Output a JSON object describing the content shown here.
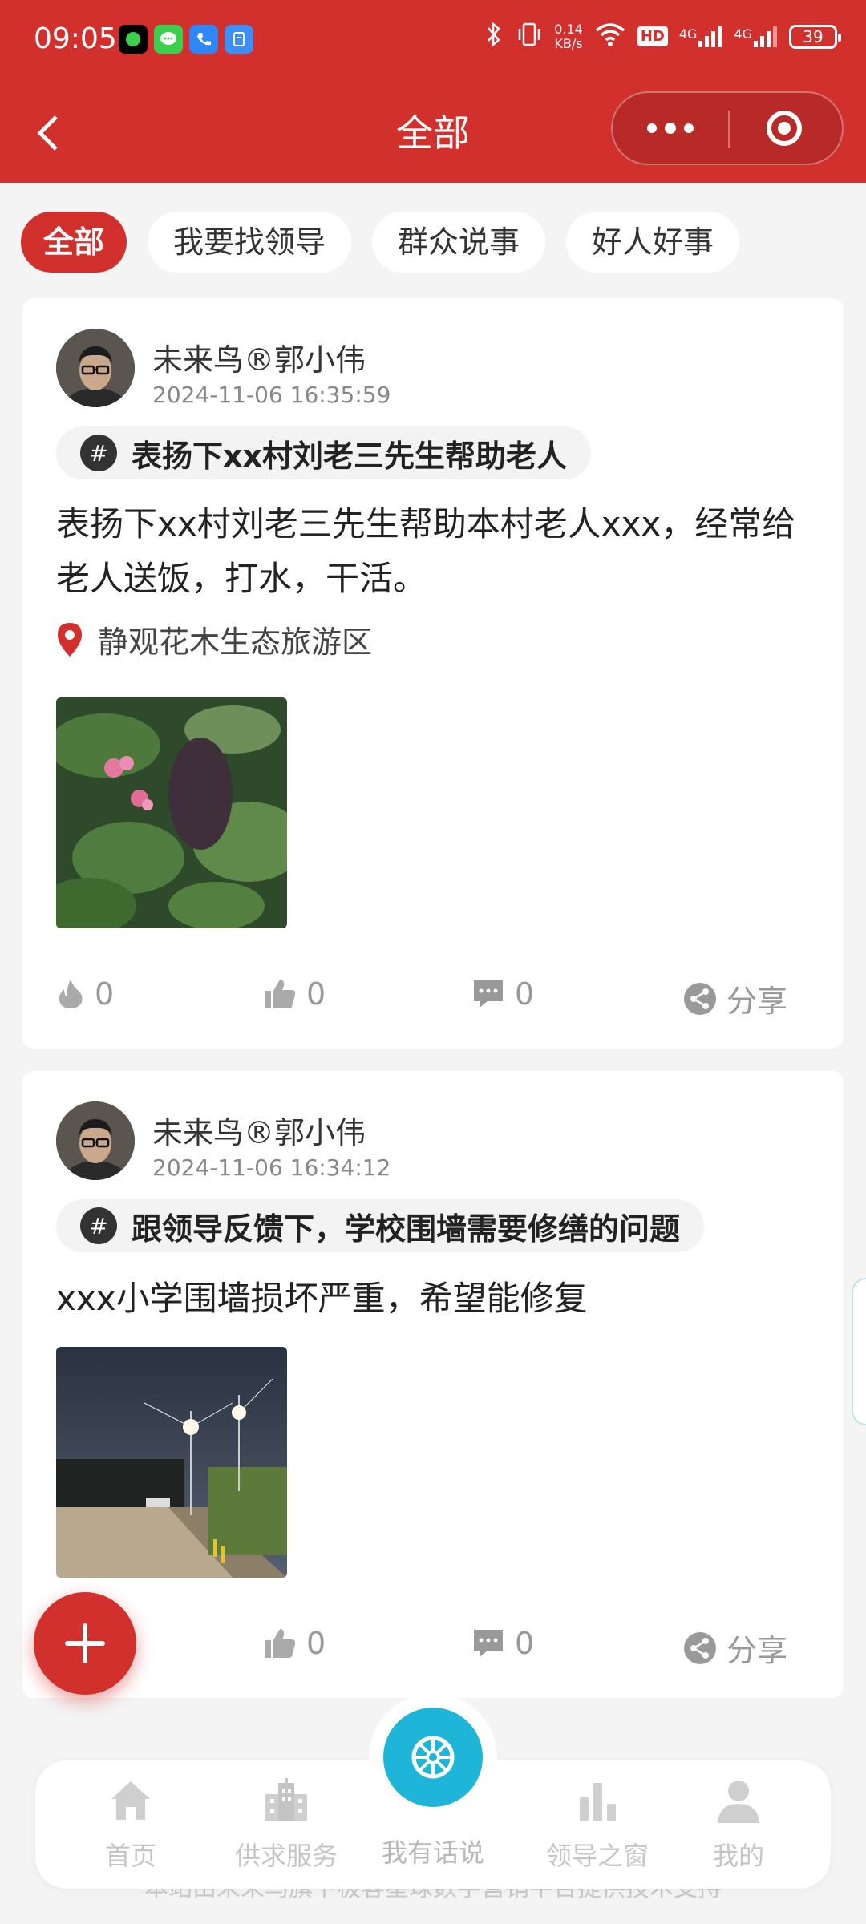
{
  "status_bar": {
    "time": "09:05",
    "network_speed_value": "0.14",
    "network_speed_unit": "KB/s",
    "hd_label": "HD",
    "signal_1": "4G",
    "signal_2": "4G",
    "battery": "39",
    "icons": [
      "wechat-app-icon",
      "message-app-icon",
      "phone-app-icon",
      "app-icon",
      "bluetooth-icon",
      "vibrate-icon",
      "wifi-icon",
      "hd-icon",
      "signal-icon",
      "battery-icon"
    ]
  },
  "nav": {
    "title": "全部"
  },
  "tabs": [
    {
      "label": "全部",
      "active": true
    },
    {
      "label": "我要找领导",
      "active": false
    },
    {
      "label": "群众说事",
      "active": false
    },
    {
      "label": "好人好事",
      "active": false
    }
  ],
  "posts": [
    {
      "author": "未来鸟®郭小伟",
      "time": "2024-11-06 16:35:59",
      "topic": "表扬下xx村刘老三先生帮助老人",
      "content": "表扬下xx村刘老三先生帮助本村老人xxx，经常给老人送饭，打水，干活。",
      "location": "静观花木生态旅游区",
      "hot": "0",
      "likes": "0",
      "comments": "0",
      "share": "分享"
    },
    {
      "author": "未来鸟®郭小伟",
      "time": "2024-11-06 16:34:12",
      "topic": "跟领导反馈下，学校围墙需要修缮的问题",
      "content": "xxx小学围墙损坏严重，希望能修复",
      "likes": "0",
      "comments": "0",
      "share": "分享"
    }
  ],
  "bottom_nav": {
    "items": [
      {
        "label": "首页",
        "icon": "home-icon"
      },
      {
        "label": "供求服务",
        "icon": "building-icon"
      },
      {
        "label": "我有话说",
        "icon": "wheel-icon"
      },
      {
        "label": "领导之窗",
        "icon": "bar-chart-icon"
      },
      {
        "label": "我的",
        "icon": "user-icon"
      }
    ],
    "footer_text": "本站由未来鸟旗下极客星球数字营销平台提供技术支持"
  },
  "colors": {
    "brand_red": "#d2302d",
    "center_button": "#1fb5d8",
    "muted_text": "#999999"
  }
}
